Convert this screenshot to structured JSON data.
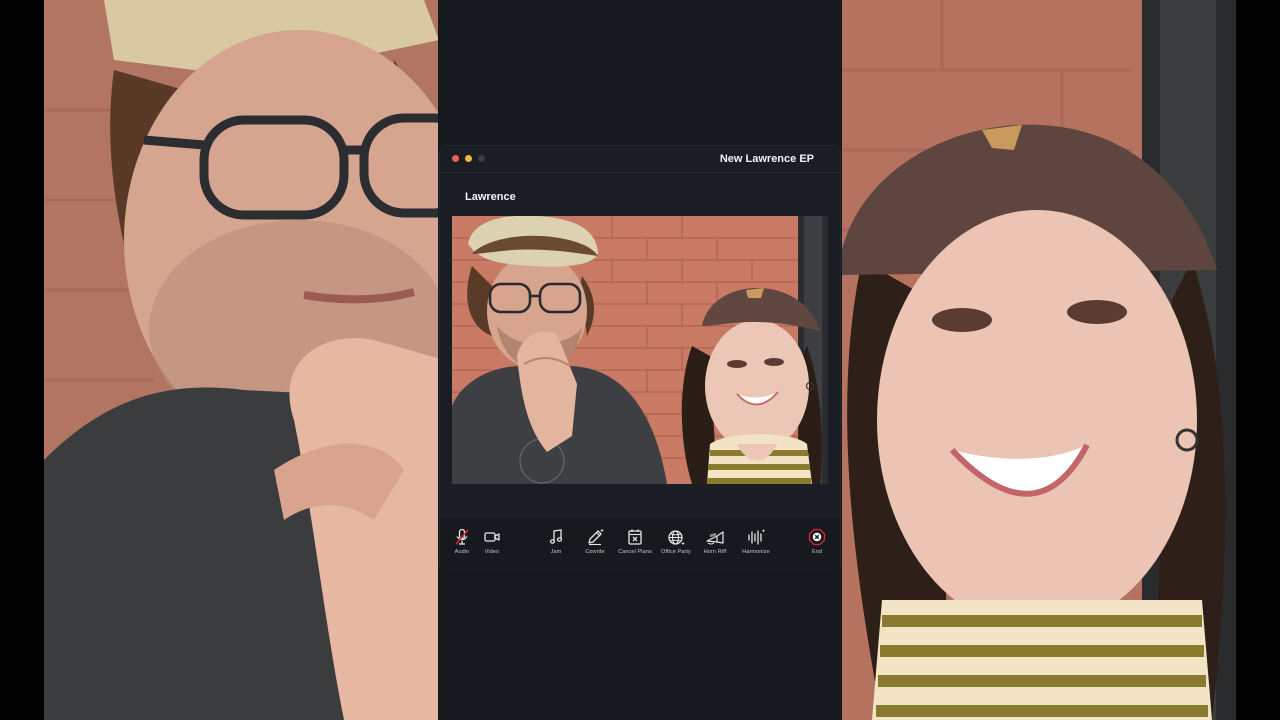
{
  "window": {
    "title": "New Lawrence EP"
  },
  "call": {
    "participant_name": "Lawrence"
  },
  "toolbar": {
    "items": [
      {
        "label": "Audio",
        "icon": "mic-muted-icon",
        "state": "muted"
      },
      {
        "label": "Video",
        "icon": "video-camera-icon"
      },
      {
        "label": "Jam",
        "icon": "music-note-icon"
      },
      {
        "label": "Cowrite",
        "icon": "pencil-sparkle-icon"
      },
      {
        "label": "Cancel Plans",
        "icon": "calendar-x-icon"
      },
      {
        "label": "Office Party",
        "icon": "globe-sparkle-icon"
      },
      {
        "label": "Horn Riff",
        "icon": "trumpet-icon"
      },
      {
        "label": "Harmonize",
        "icon": "waveform-sparkle-icon"
      },
      {
        "label": "End",
        "icon": "end-call-icon"
      }
    ]
  },
  "colors": {
    "end_button": "#e0242f",
    "mute_slash": "#e0242f",
    "window_bg": "#1a1e24",
    "page_bg": "#15181d"
  }
}
